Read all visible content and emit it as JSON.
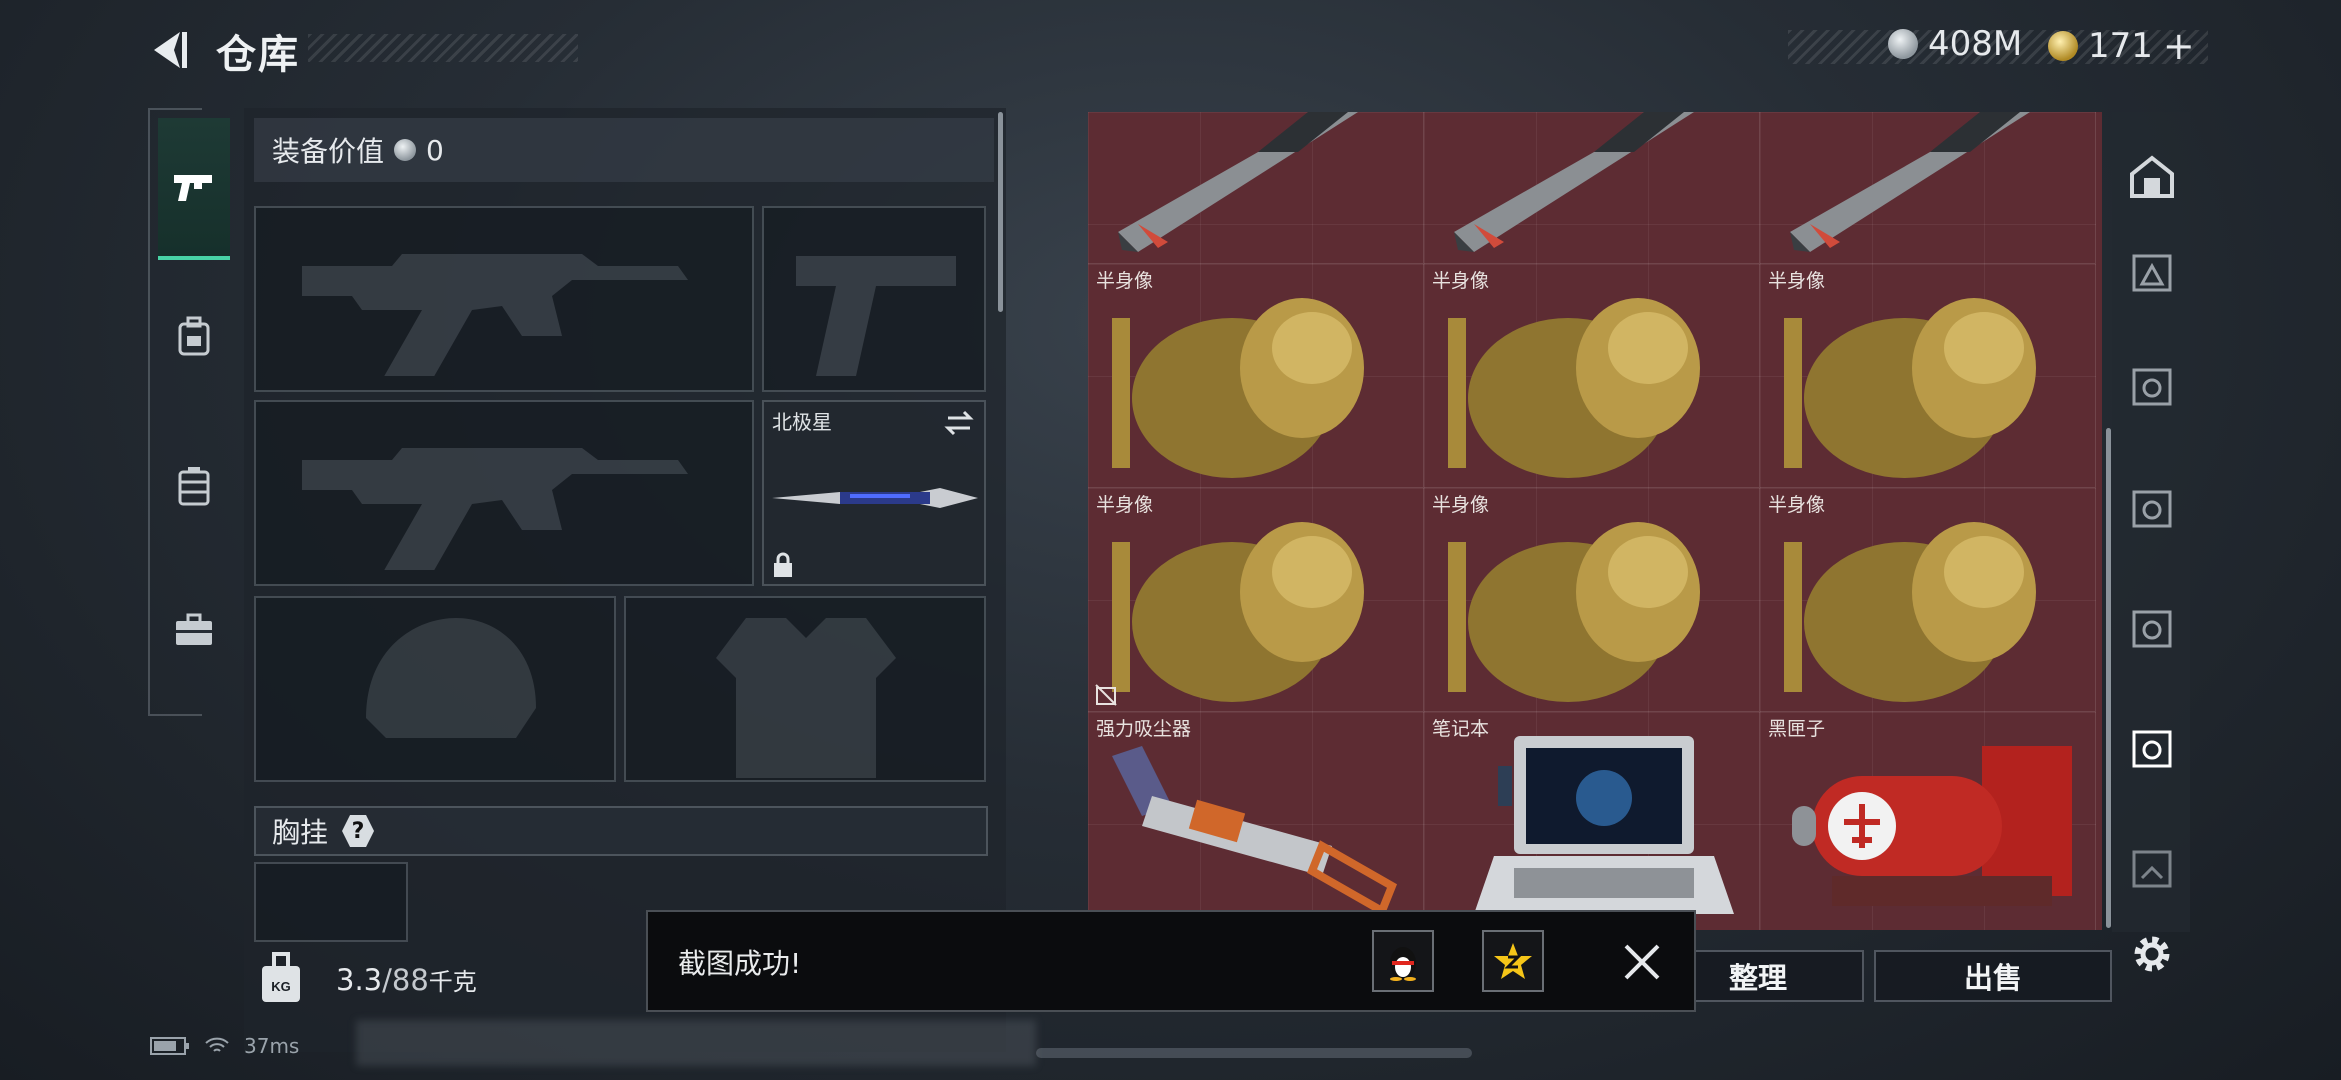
{
  "header": {
    "title": "仓库",
    "currency_silver": "408M",
    "currency_gold": "171",
    "currency_gold_add": "+",
    "colors": {
      "silver": "#b9c2c9",
      "gold": "#d8b54a"
    }
  },
  "equipment": {
    "value_label": "装备价值",
    "value": "0",
    "melee_name": "北极星",
    "chest_label": "胸挂",
    "chest_help": "?",
    "weight_current": "3.3",
    "weight_max": "/88",
    "weight_unit": "千克",
    "weight_icon_text": "KG"
  },
  "stash": {
    "background_color": "#5d2c33",
    "row1": [
      "",
      "",
      ""
    ],
    "row2": [
      "半身像",
      "半身像",
      "半身像"
    ],
    "row3": [
      "半身像",
      "半身像",
      "半身像"
    ],
    "row4": [
      "强力吸尘器",
      "笔记本",
      "黑匣子"
    ]
  },
  "actions": {
    "organize": "整理",
    "sell": "出售"
  },
  "toast": {
    "message": "截图成功!",
    "qq_icon": "penguin-icon",
    "qzone_icon": "star-icon"
  },
  "status": {
    "ping": "37ms"
  }
}
